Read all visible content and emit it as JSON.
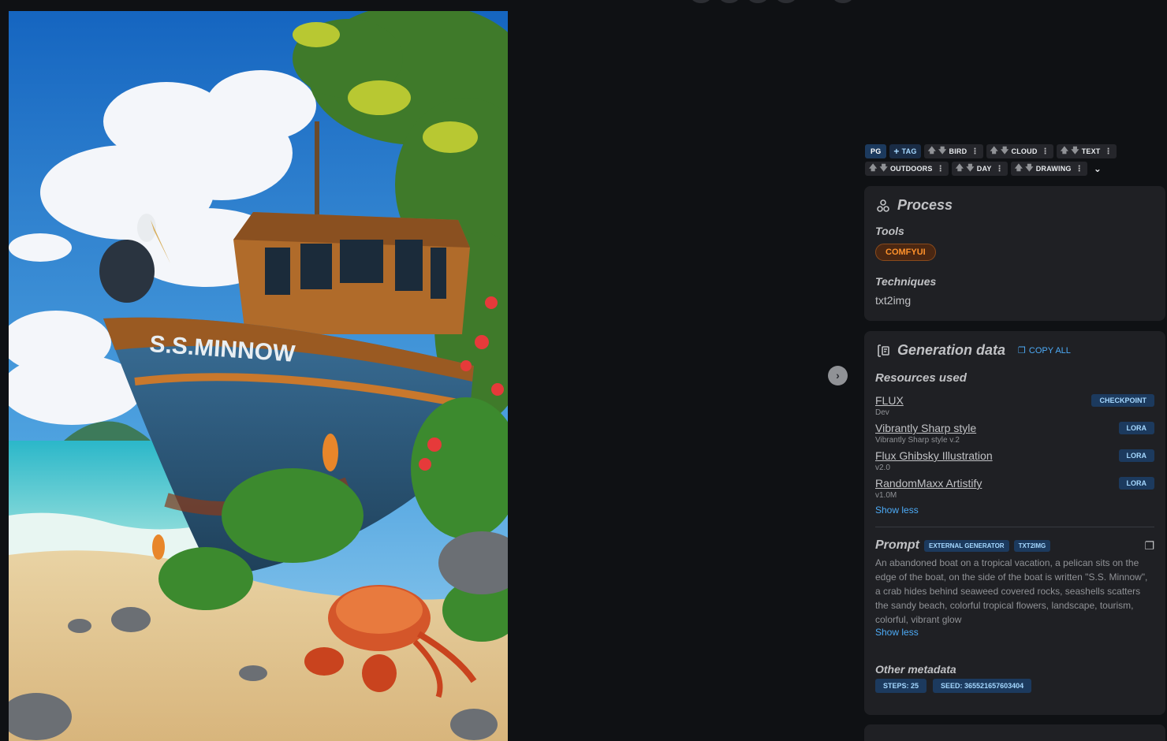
{
  "tags": {
    "rating": "PG",
    "add_label": "TAG",
    "items": [
      "BIRD",
      "CLOUD",
      "TEXT",
      "OUTDOORS",
      "DAY",
      "DRAWING"
    ]
  },
  "process": {
    "title": "Process",
    "tools_label": "Tools",
    "tool": "COMFYUI",
    "techniques_label": "Techniques",
    "technique": "txt2img"
  },
  "generation": {
    "title": "Generation data",
    "copy_all": "COPY ALL",
    "resources_label": "Resources used",
    "resources": [
      {
        "name": "FLUX",
        "version": "Dev",
        "type": "CHECKPOINT"
      },
      {
        "name": "Vibrantly Sharp style",
        "version": "Vibrantly Sharp style v.2",
        "type": "LORA"
      },
      {
        "name": "Flux Ghibsky Illustration",
        "version": "v2.0",
        "type": "LORA"
      },
      {
        "name": "RandomMaxx Artistify",
        "version": "v1.0M",
        "type": "LORA"
      }
    ],
    "show_less_resources": "Show less",
    "prompt_label": "Prompt",
    "prompt_badges": [
      "EXTERNAL GENERATOR",
      "TXT2IMG"
    ],
    "prompt": "An abandoned boat on a tropical vacation, a pelican sits on the edge of the boat, on the side of the boat is written \"S.S. Minnow\", a crab hides behind seaweed covered rocks, seashells scatters the sandy beach, colorful tropical flowers, landscape, tourism, colorful, vibrant glow",
    "show_less_prompt": "Show less",
    "other_label": "Other metadata",
    "steps": "STEPS: 25",
    "seed": "SEED: 365521657603404"
  },
  "artwork": {
    "boat_name": "S.S.MINNOW"
  },
  "icons": {
    "next": "chevron-right-icon",
    "process": "process-icon",
    "generation": "generation-data-icon",
    "copy": "copy-icon",
    "expand": "chevron-down-icon"
  }
}
